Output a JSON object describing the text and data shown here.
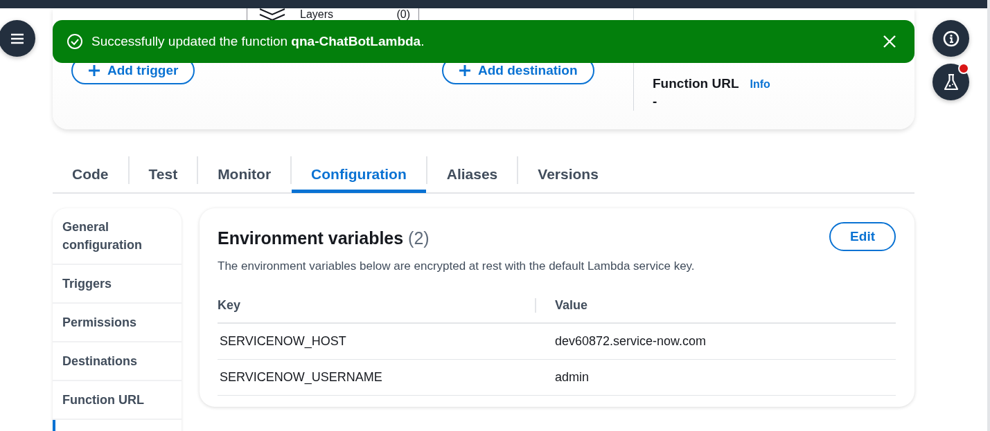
{
  "layers": {
    "label": "Layers",
    "count": "(0)"
  },
  "trigger_button": "Add trigger",
  "destination_button": "Add destination",
  "function_url": {
    "label": "Function URL",
    "info": "Info",
    "value": "-"
  },
  "notification": {
    "prefix": "Successfully updated the function ",
    "name": "qna-ChatBotLambda",
    "suffix": "."
  },
  "side_buttons": [
    {
      "kind": "info",
      "badge": false
    },
    {
      "kind": "lab",
      "badge": true
    }
  ],
  "tabs": [
    {
      "label": "Code",
      "selected": false
    },
    {
      "label": "Test",
      "selected": false
    },
    {
      "label": "Monitor",
      "selected": false
    },
    {
      "label": "Configuration",
      "selected": true
    },
    {
      "label": "Aliases",
      "selected": false
    },
    {
      "label": "Versions",
      "selected": false
    }
  ],
  "sidebar": {
    "items": [
      {
        "label": "General configuration",
        "selected": false
      },
      {
        "label": "Triggers",
        "selected": false
      },
      {
        "label": "Permissions",
        "selected": false
      },
      {
        "label": "Destinations",
        "selected": false
      },
      {
        "label": "Function URL",
        "selected": false
      },
      {
        "selected": true
      }
    ]
  },
  "env": {
    "title": "Environment variables",
    "count": "(2)",
    "edit": "Edit",
    "description": "The environment variables below are encrypted at rest with the default Lambda service key.",
    "columns": [
      "Key",
      "Value"
    ],
    "rows": [
      [
        "SERVICENOW_HOST",
        "dev60872.service-now.com"
      ],
      [
        "SERVICENOW_USERNAME",
        "admin"
      ]
    ]
  }
}
